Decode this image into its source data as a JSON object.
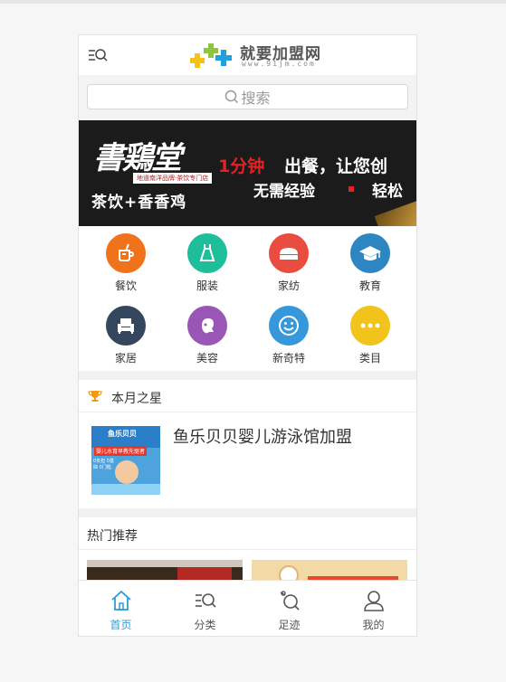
{
  "header": {
    "logo_name": "就要加盟网",
    "logo_url": "www.91jm.com",
    "menu_icon": "menu-search-icon"
  },
  "search": {
    "placeholder": "搜索",
    "icon": "search-icon"
  },
  "banner": {
    "brand": "書鶏堂",
    "tag": "地道南洋品牌·茶饮专门店",
    "subtitle": "茶饮+香香鸡",
    "headline_red": "1分钟",
    "headline_white": "出餐，让您创",
    "line2_a": "无需经验",
    "line2_b": "轻松"
  },
  "categories": [
    {
      "label": "餐饮",
      "icon": "drink-icon",
      "color": "#f0731b"
    },
    {
      "label": "服装",
      "icon": "dress-icon",
      "color": "#1fbe9a"
    },
    {
      "label": "家纺",
      "icon": "bedding-icon",
      "color": "#ea4c3f"
    },
    {
      "label": "教育",
      "icon": "graduation-cap-icon",
      "color": "#2d85c1"
    },
    {
      "label": "家居",
      "icon": "armchair-icon",
      "color": "#35475e"
    },
    {
      "label": "美容",
      "icon": "face-icon",
      "color": "#9a56b6"
    },
    {
      "label": "新奇特",
      "icon": "smile-icon",
      "color": "#3598db"
    },
    {
      "label": "类目",
      "icon": "more-icon",
      "color": "#f2c31a"
    }
  ],
  "star": {
    "title": "本月之星",
    "icon": "trophy-icon",
    "item_name": "鱼乐贝贝婴儿游泳馆加盟",
    "thumb_brand": "鱼乐贝贝",
    "thumb_slogan": "婴儿水育早教先驱者",
    "thumb_footer": "0负担 0基础 0门槛"
  },
  "hot": {
    "title": "热门推荐"
  },
  "tabbar": [
    {
      "label": "首页",
      "icon": "home-icon",
      "active": true
    },
    {
      "label": "分类",
      "icon": "category-search-icon",
      "active": false
    },
    {
      "label": "足迹",
      "icon": "footprint-icon",
      "active": false
    },
    {
      "label": "我的",
      "icon": "user-icon",
      "active": false
    }
  ],
  "colors": {
    "accent": "#2d9cdb",
    "trophy": "#f29a16"
  }
}
